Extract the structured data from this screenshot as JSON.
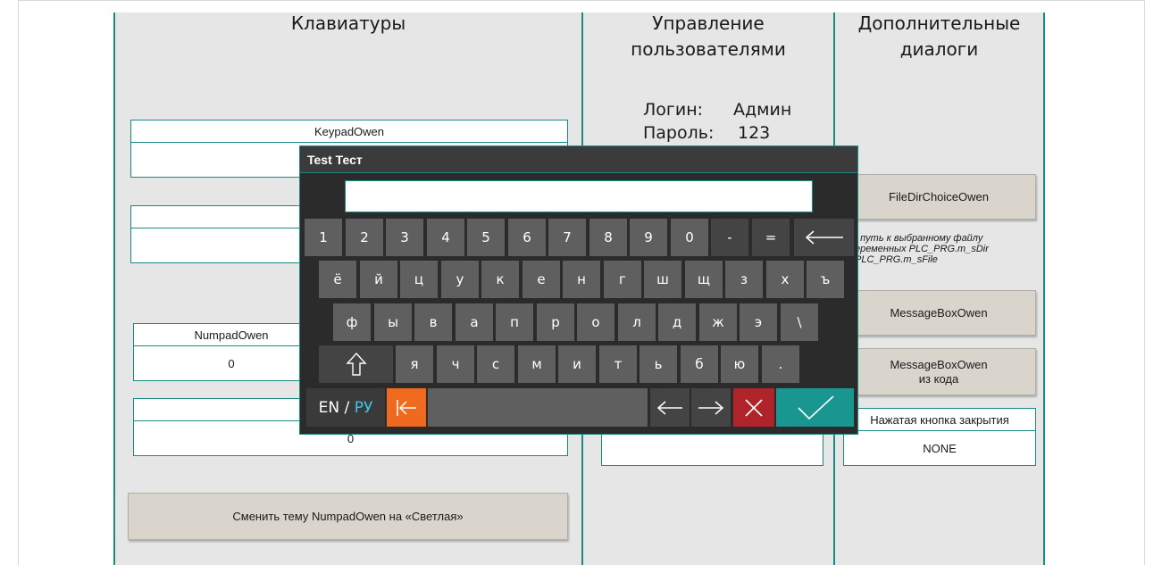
{
  "sections": {
    "keyboards_title": "Клавиатуры",
    "users_title_line1": "Управление",
    "users_title_line2": "пользователями",
    "dialogs_title_line1": "Дополнительные",
    "dialogs_title_line2": "диалоги"
  },
  "keyboards": {
    "keypad_label": "KeypadOwen",
    "numpad_label": "NumpadOwen",
    "numpad_value": "0",
    "field3_value": "0",
    "theme_button": "Сменить тему NumpadOwen на «Светлая»"
  },
  "users": {
    "login_label": "Логин:",
    "login_value": "Админ",
    "password_label": "Пароль:",
    "password_value": "123"
  },
  "dialogs": {
    "filedir_button": "FileDirChoiceOwen",
    "note_line1": ". путь к выбранному файлу",
    "note_line2": "еременных PLC_PRG.m_sDir",
    "note_line3": "PLC_PRG.m_sFile",
    "msgbox_button": "MessageBoxOwen",
    "msgbox_code_line1": "MessageBoxOwen",
    "msgbox_code_line2": "из кода",
    "close_button_label": "Нажатая кнопка закрытия",
    "close_button_value": "NONE"
  },
  "keyboard": {
    "title": "Test Тест",
    "input_value": "",
    "row1": [
      "1",
      "2",
      "3",
      "4",
      "5",
      "6",
      "7",
      "8",
      "9",
      "0",
      "-",
      "="
    ],
    "row2": [
      "ё",
      "й",
      "ц",
      "у",
      "к",
      "е",
      "н",
      "г",
      "ш",
      "щ",
      "з",
      "х",
      "ъ"
    ],
    "row3": [
      "ф",
      "ы",
      "в",
      "а",
      "п",
      "р",
      "о",
      "л",
      "д",
      "ж",
      "э",
      "\\"
    ],
    "row4": [
      "я",
      "ч",
      "с",
      "м",
      "и",
      "т",
      "ь",
      "б",
      "ю",
      "."
    ],
    "lang_en": "EN",
    "lang_sep": " / ",
    "lang_ru": "РУ",
    "icons": {
      "backspace": "backspace-arrow-icon",
      "shift": "shift-arrow-icon",
      "home": "home-bar-arrow-icon",
      "left": "left-arrow-icon",
      "right": "right-arrow-icon",
      "cancel": "cross-icon",
      "ok": "checkmark-icon"
    }
  },
  "colors": {
    "accent": "#1a8a82",
    "panel": "#e6e6e6",
    "button": "#d9d5cc",
    "key": "#5f5f5f",
    "orange": "#ef6a1f",
    "red": "#b1232a",
    "green": "#19968f",
    "ru_text": "#3ec7ea"
  }
}
